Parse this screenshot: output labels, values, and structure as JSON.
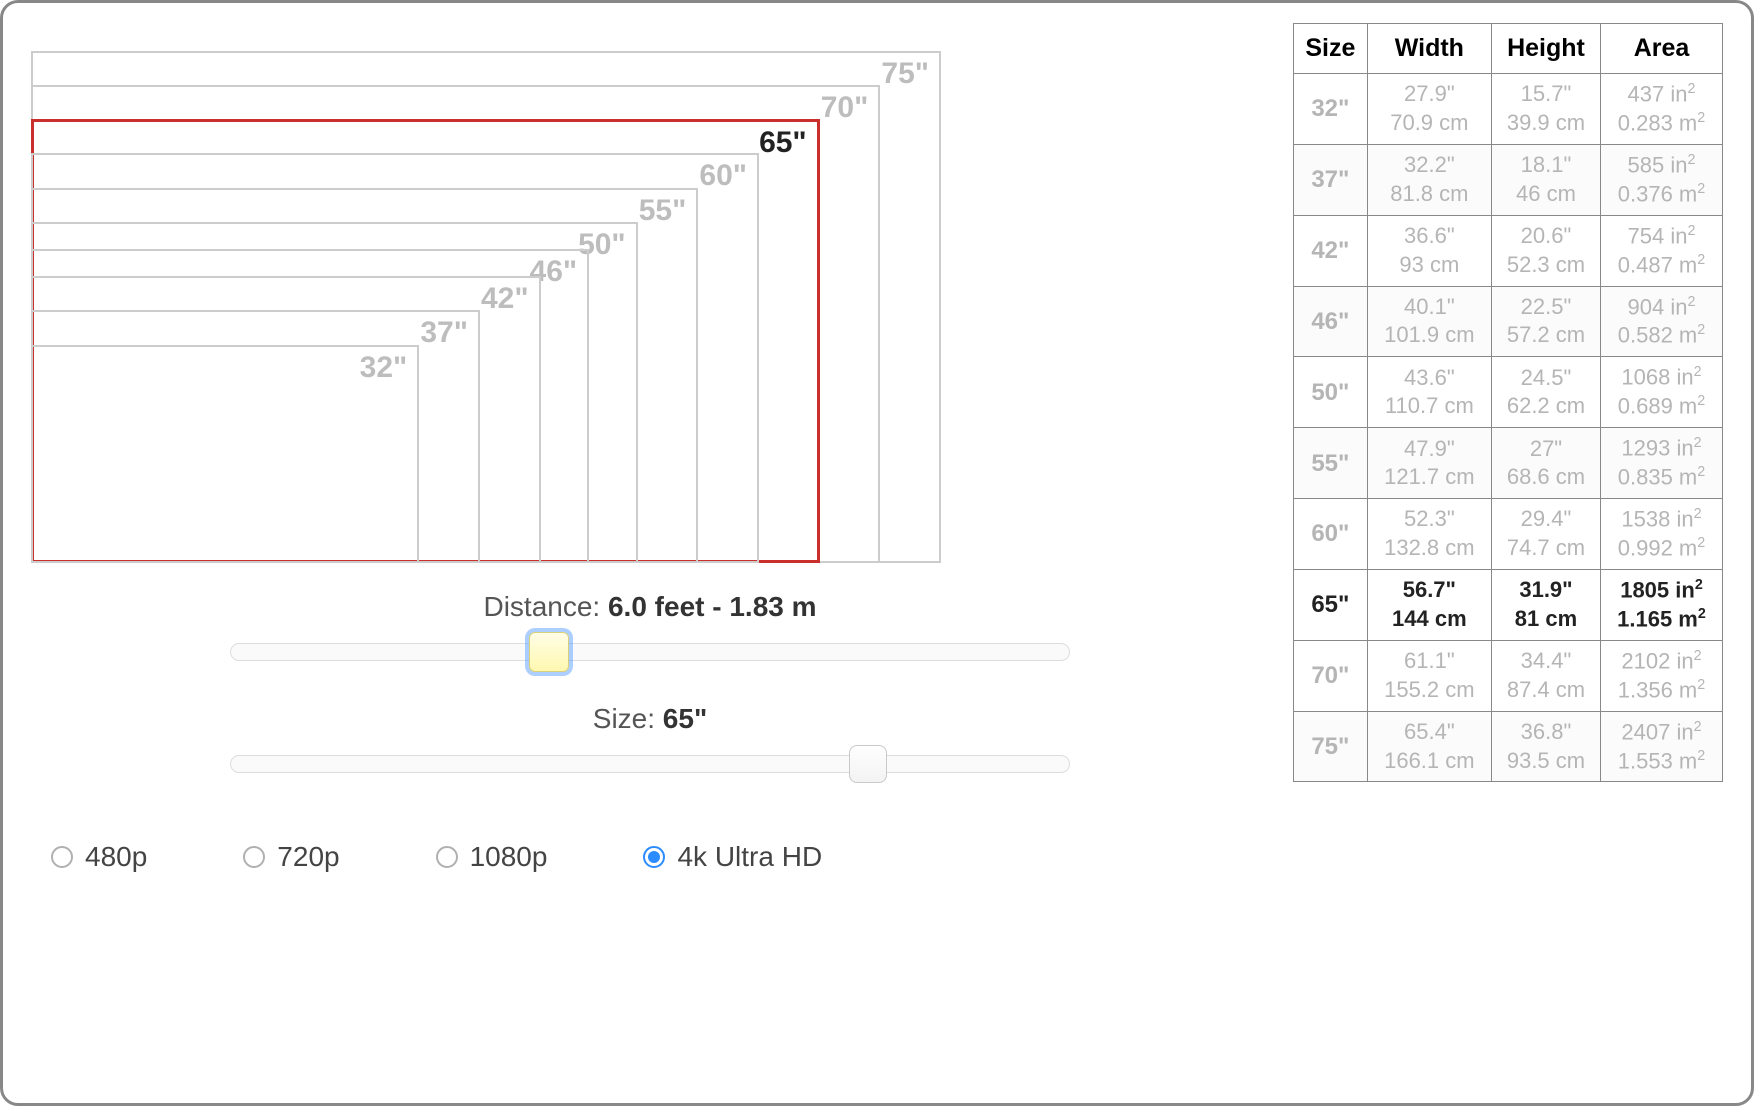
{
  "diagram": {
    "selected_size": "65\"",
    "sizes": [
      "32\"",
      "37\"",
      "42\"",
      "46\"",
      "50\"",
      "55\"",
      "60\"",
      "65\"",
      "70\"",
      "75\""
    ]
  },
  "controls": {
    "distance_label": "Distance: ",
    "distance_value": "6.0 feet - 1.83 m",
    "size_label": "Size: ",
    "size_value": "65\"",
    "distance_slider_pct": 38,
    "size_slider_pct": 76
  },
  "resolutions": {
    "options": [
      "480p",
      "720p",
      "1080p",
      "4k Ultra HD"
    ],
    "selected": "4k Ultra HD"
  },
  "table": {
    "headers": [
      "Size",
      "Width",
      "Height",
      "Area"
    ],
    "active_size": "65\"",
    "rows": [
      {
        "size": "32\"",
        "width_in": "27.9\"",
        "width_cm": "70.9 cm",
        "height_in": "15.7\"",
        "height_cm": "39.9 cm",
        "area_in": "437 in",
        "area_m": "0.283 m"
      },
      {
        "size": "37\"",
        "width_in": "32.2\"",
        "width_cm": "81.8 cm",
        "height_in": "18.1\"",
        "height_cm": "46 cm",
        "area_in": "585 in",
        "area_m": "0.376 m"
      },
      {
        "size": "42\"",
        "width_in": "36.6\"",
        "width_cm": "93 cm",
        "height_in": "20.6\"",
        "height_cm": "52.3 cm",
        "area_in": "754 in",
        "area_m": "0.487 m"
      },
      {
        "size": "46\"",
        "width_in": "40.1\"",
        "width_cm": "101.9 cm",
        "height_in": "22.5\"",
        "height_cm": "57.2 cm",
        "area_in": "904 in",
        "area_m": "0.582 m"
      },
      {
        "size": "50\"",
        "width_in": "43.6\"",
        "width_cm": "110.7 cm",
        "height_in": "24.5\"",
        "height_cm": "62.2 cm",
        "area_in": "1068 in",
        "area_m": "0.689 m"
      },
      {
        "size": "55\"",
        "width_in": "47.9\"",
        "width_cm": "121.7 cm",
        "height_in": "27\"",
        "height_cm": "68.6 cm",
        "area_in": "1293 in",
        "area_m": "0.835 m"
      },
      {
        "size": "60\"",
        "width_in": "52.3\"",
        "width_cm": "132.8 cm",
        "height_in": "29.4\"",
        "height_cm": "74.7 cm",
        "area_in": "1538 in",
        "area_m": "0.992 m"
      },
      {
        "size": "65\"",
        "width_in": "56.7\"",
        "width_cm": "144 cm",
        "height_in": "31.9\"",
        "height_cm": "81 cm",
        "area_in": "1805 in",
        "area_m": "1.165 m"
      },
      {
        "size": "70\"",
        "width_in": "61.1\"",
        "width_cm": "155.2 cm",
        "height_in": "34.4\"",
        "height_cm": "87.4 cm",
        "area_in": "2102 in",
        "area_m": "1.356 m"
      },
      {
        "size": "75\"",
        "width_in": "65.4\"",
        "width_cm": "166.1 cm",
        "height_in": "36.8\"",
        "height_cm": "93.5 cm",
        "area_in": "2407 in",
        "area_m": "1.553 m"
      }
    ]
  }
}
